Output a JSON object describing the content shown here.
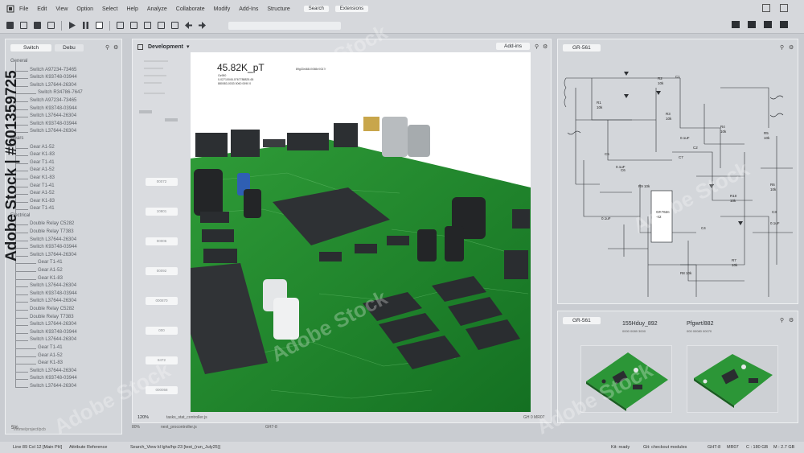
{
  "menu": {
    "items": [
      "File",
      "Edit",
      "View",
      "Option",
      "Select",
      "Help",
      "Analyze",
      "Collaborate",
      "Modify",
      "Add-Ins",
      "Structure"
    ],
    "search_label": "Search",
    "extensions_label": "Extensions"
  },
  "left_panel": {
    "tab_switch": "Switch",
    "tab_debug": "Debu",
    "groups": [
      {
        "label": "General",
        "items": [
          "Switch A97234-73465",
          "Switch K93748-03944",
          "Switch L37644-26304",
          "Switch R34786-7647",
          "Switch A97234-73465",
          "Switch K93748-03944",
          "Switch L37644-26304",
          "Switch K93748-03944",
          "Switch L37644-26304"
        ]
      },
      {
        "label": "Gears",
        "items": [
          "Gear A1-52",
          "Gear K1-83",
          "Gear T1-41",
          "Gear A1-52",
          "Gear K1-83",
          "Gear T1-41",
          "Gear A1-52",
          "Gear K1-83",
          "Gear T1-41"
        ]
      },
      {
        "label": "Electrical",
        "items": [
          "Double Relay C5282",
          "Double Relay T7383",
          "Switch L37644-26304",
          "Switch K93748-03944",
          "Switch L37644-26304",
          "Gear T1-41",
          "Gear A1-52",
          "Gear K1-83",
          "Switch L37644-26304",
          "Switch K93748-03944",
          "Switch L37644-26304"
        ]
      },
      {
        "label": "",
        "items": [
          "Double Relay C5282",
          "Double Relay T7383",
          "Switch L37644-26304",
          "Switch K93748-03944",
          "Switch L37644-26304",
          "Gear T1-41",
          "Gear A1-52",
          "Gear K1-83",
          "Switch L37644-26304",
          "Switch K93748-03944",
          "Switch L37644-26304"
        ]
      }
    ],
    "bottom_path": "/home/project/pcb"
  },
  "doc_panel": {
    "title": "Development",
    "addins_label": "Add-ins",
    "side_buttons": [
      "00072",
      "10801",
      "00006",
      "00092",
      "000870",
      "000",
      "8472",
      "000058"
    ],
    "heading": "45.82K_pT",
    "heading_sub1": "Gz950",
    "heading_sub2": "0-02710045-0767788825-65",
    "heading_sub3": "880083-0033 0060 0090 0",
    "heading_code": "89g33r46845065e5037f",
    "zoom": "120%",
    "status_path": "tasks_stat_controller.js",
    "status_right": "GH 0 MR07"
  },
  "schematic_panel": {
    "tab_label": "GR-561",
    "labels": {
      "r1": "R1",
      "r1v": "10k",
      "c1": "C1",
      "r2": "R2",
      "r2v": "10k",
      "r3": "R3",
      "r3v": "10k",
      "r4": "R4",
      "r4v": "10k",
      "r5": "R5",
      "r5v": "10k",
      "r6": "R6",
      "r6v": "10k",
      "r7": "R7",
      "r7v": "10k",
      "r8": "R8 10k",
      "r9": "R9 10k",
      "r10": "R10",
      "r10v": "10k",
      "c2": "C2",
      "c3": "C3",
      "c4": "C4",
      "c5": "C5",
      "c6": "C6",
      "c7": "C7",
      "ic": "GR7626",
      "ic2": "-62",
      "cap1": "0.1uF",
      "cap2": "0.1uF",
      "cap3": "0.1uF",
      "cap4": "0.1uF"
    }
  },
  "preview_panel": {
    "tab_label": "GR-561",
    "label_left": "155Hduy_892",
    "label_right": "Pfgwrt/882",
    "sub_left": "0000 0089 3000",
    "sub_right": "000 00080 00070"
  },
  "mini_bar": {
    "zoom": "80%",
    "path": "next_procontroller.js",
    "right": "GH7-8"
  },
  "statusbar": {
    "position": "Line 89 Col 12 [Main PH]",
    "reference": "Attribute Reference",
    "search": "Search_View kl lghs/hp-23 [test_(run_July25)]",
    "kit": "Kit: ready",
    "git": "Git: checkout modules",
    "branch": "GHT-8",
    "mr": "MR07",
    "cpu": "C : 180 GB",
    "mem": "M : 2.7 GB"
  },
  "watermark": "Adobe Stock",
  "stock_id": "Adobe Stock | #601359725",
  "colors": {
    "board": "#1f8a2a",
    "board_dark": "#14611c",
    "chip": "#2a2d30",
    "accent": "#f4f5f6"
  }
}
